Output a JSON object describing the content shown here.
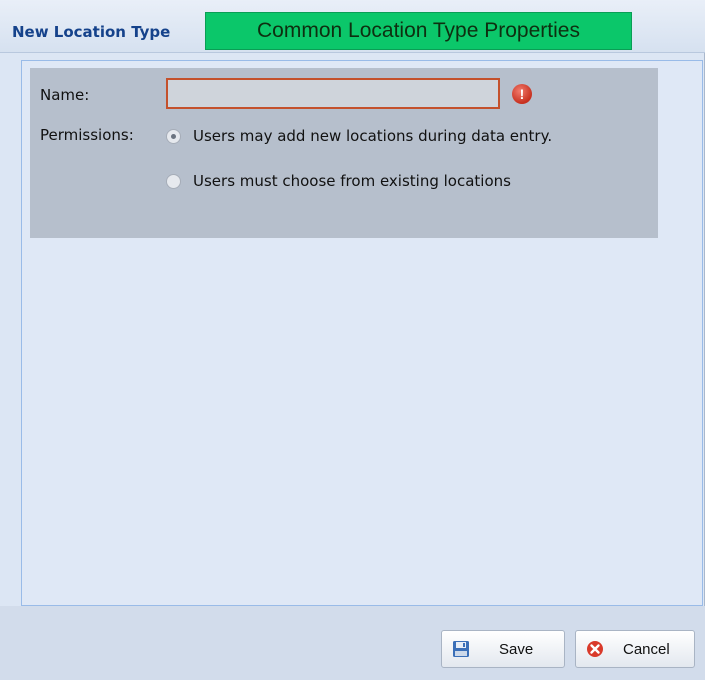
{
  "window": {
    "title": "New Location Type",
    "callout": "Common Location Type Properties"
  },
  "form": {
    "name_label": "Name:",
    "name_value": "",
    "permissions_label": "Permissions:",
    "options": [
      {
        "label": "Users may add new locations during data entry.",
        "selected": true
      },
      {
        "label": "Users must choose from existing locations",
        "selected": false
      }
    ],
    "error_icon_glyph": "!"
  },
  "footer": {
    "save_label": "Save",
    "cancel_label": "Cancel"
  },
  "colors": {
    "callout_bg": "#0bc76a",
    "title_text": "#15428b",
    "error": "#c7301f",
    "invalid_border": "#c4512c"
  },
  "icons": {
    "save": "floppy-disk-icon",
    "cancel": "cancel-icon",
    "error": "exclamation-icon"
  }
}
